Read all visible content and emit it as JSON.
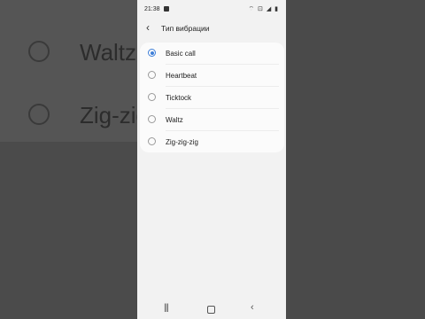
{
  "background": {
    "items": [
      "Waltz",
      "Zig-zig"
    ]
  },
  "statusbar": {
    "time": "21:38",
    "icons": "⌔ ⊡ ◢ ▮"
  },
  "header": {
    "back_icon": "‹",
    "title": "Тип вибрации"
  },
  "options": [
    {
      "label": "Basic call",
      "selected": true
    },
    {
      "label": "Heartbeat",
      "selected": false
    },
    {
      "label": "Ticktock",
      "selected": false
    },
    {
      "label": "Waltz",
      "selected": false
    },
    {
      "label": "Zig-zig-zig",
      "selected": false
    }
  ],
  "navbar": {
    "recent_icon": "|||",
    "back_icon": "‹"
  },
  "colors": {
    "accent": "#3e7fd9"
  }
}
